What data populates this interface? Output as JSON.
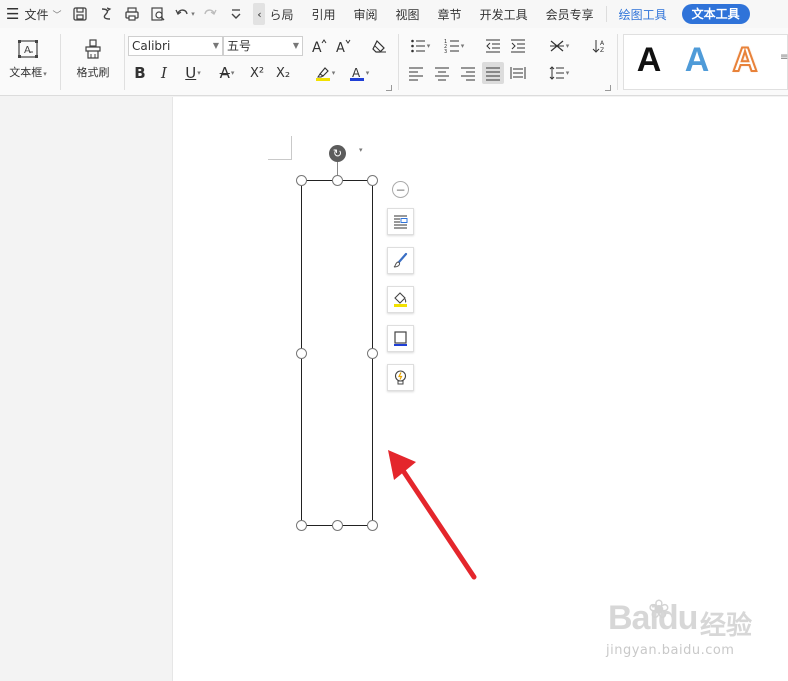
{
  "menubar": {
    "menu_label": "文件",
    "tabs": [
      {
        "label": "布局",
        "shown": "ら局"
      },
      {
        "label": "引用"
      },
      {
        "label": "审阅"
      },
      {
        "label": "视图"
      },
      {
        "label": "章节"
      },
      {
        "label": "开发工具"
      },
      {
        "label": "会员专享"
      },
      {
        "label": "绘图工具"
      },
      {
        "label": "文本工具"
      }
    ]
  },
  "ribbon": {
    "textbox_label": "文本框",
    "format_painter_label": "格式刷",
    "font_name": "Calibri",
    "font_size": "五号",
    "wordart_letter": "A"
  },
  "colors": {
    "accent": "#2f73d9",
    "highlight_bar": "#f2e100",
    "font_color_bar": "#1f3fd6",
    "wordart_blue": "#4f9bd8",
    "wordart_orange": "#e8823a",
    "annotation_arrow": "#e4262c"
  },
  "watermark": {
    "logo": "Baidu",
    "cn": "经验",
    "url": "jingyan.baidu.com"
  }
}
